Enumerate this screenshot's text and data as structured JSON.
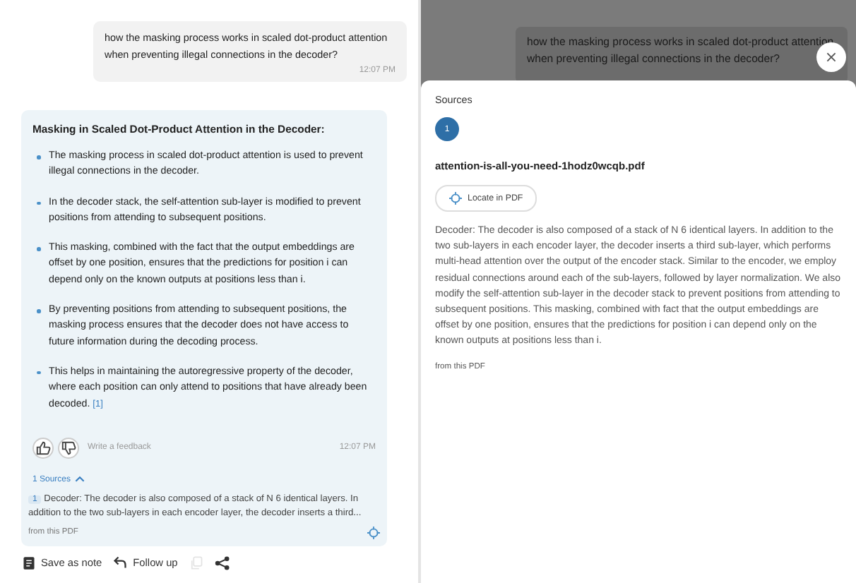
{
  "chat": {
    "user_message": {
      "text": "how the masking process works in scaled dot-product attention when preventing illegal connections in the decoder?",
      "time": "12:07 PM"
    },
    "answer": {
      "title": "Masking in Scaled Dot-Product Attention in the Decoder:",
      "bullets": [
        {
          "text": "The masking process in scaled dot-product attention is used to prevent illegal connections in the decoder."
        },
        {
          "text": "In the decoder stack, the self-attention sub-layer is modified to prevent positions from attending to subsequent positions."
        },
        {
          "text": "This masking, combined with the fact that the output embeddings are offset by one position, ensures that the predictions for position i can depend only on the known outputs at positions less than i."
        },
        {
          "text": "By preventing positions from attending to subsequent positions, the masking process ensures that the decoder does not have access to future information during the decoding process."
        },
        {
          "text": "This helps in maintaining the autoregressive property of the decoder, where each position can only attend to positions that have already been decoded.",
          "citation": "[1]"
        }
      ],
      "feedback_placeholder": "Write a feedback",
      "time": "12:07 PM",
      "sources": {
        "toggle": "1 Sources",
        "expanded": true,
        "items": [
          {
            "number": "1",
            "snippet": "Decoder: The decoder is also composed of a stack of N 6 identical layers. In addition to the two sub-layers in each encoder layer, the decoder inserts a third...",
            "origin": "from this PDF"
          }
        ]
      }
    },
    "actions": [
      {
        "kind": "save",
        "label": "Save as note",
        "disabled": false
      },
      {
        "kind": "reply",
        "label": "Follow up",
        "disabled": false
      },
      {
        "kind": "copy",
        "disabled": true
      },
      {
        "kind": "share",
        "disabled": false
      }
    ]
  },
  "sources_panel": {
    "backdrop_message": "how the masking process works in scaled dot-product attention when preventing illegal connections in the decoder?",
    "title": "Sources",
    "tabs": [
      {
        "label": "1",
        "selected": true
      }
    ],
    "filename": "attention-is-all-you-need-1hodz0wcqb.pdf",
    "locate_button": "Locate in PDF",
    "excerpt": "Decoder: The decoder is also composed of a stack of N 6 identical layers. In addition to the two sub-layers in each encoder layer, the decoder inserts a third sub-layer, which performs multi-head attention over the output of the encoder stack. Similar to the encoder, we employ residual connections around each of the sub-layers, followed by layer normalization. We also modify the self-attention sub-layer in the decoder stack to prevent positions from attending to subsequent positions. This masking, combined with fact that the output embeddings are offset by one position, ensures that the predictions for position i can depend only on the known outputs at positions less than i.",
    "origin": "from this PDF"
  }
}
